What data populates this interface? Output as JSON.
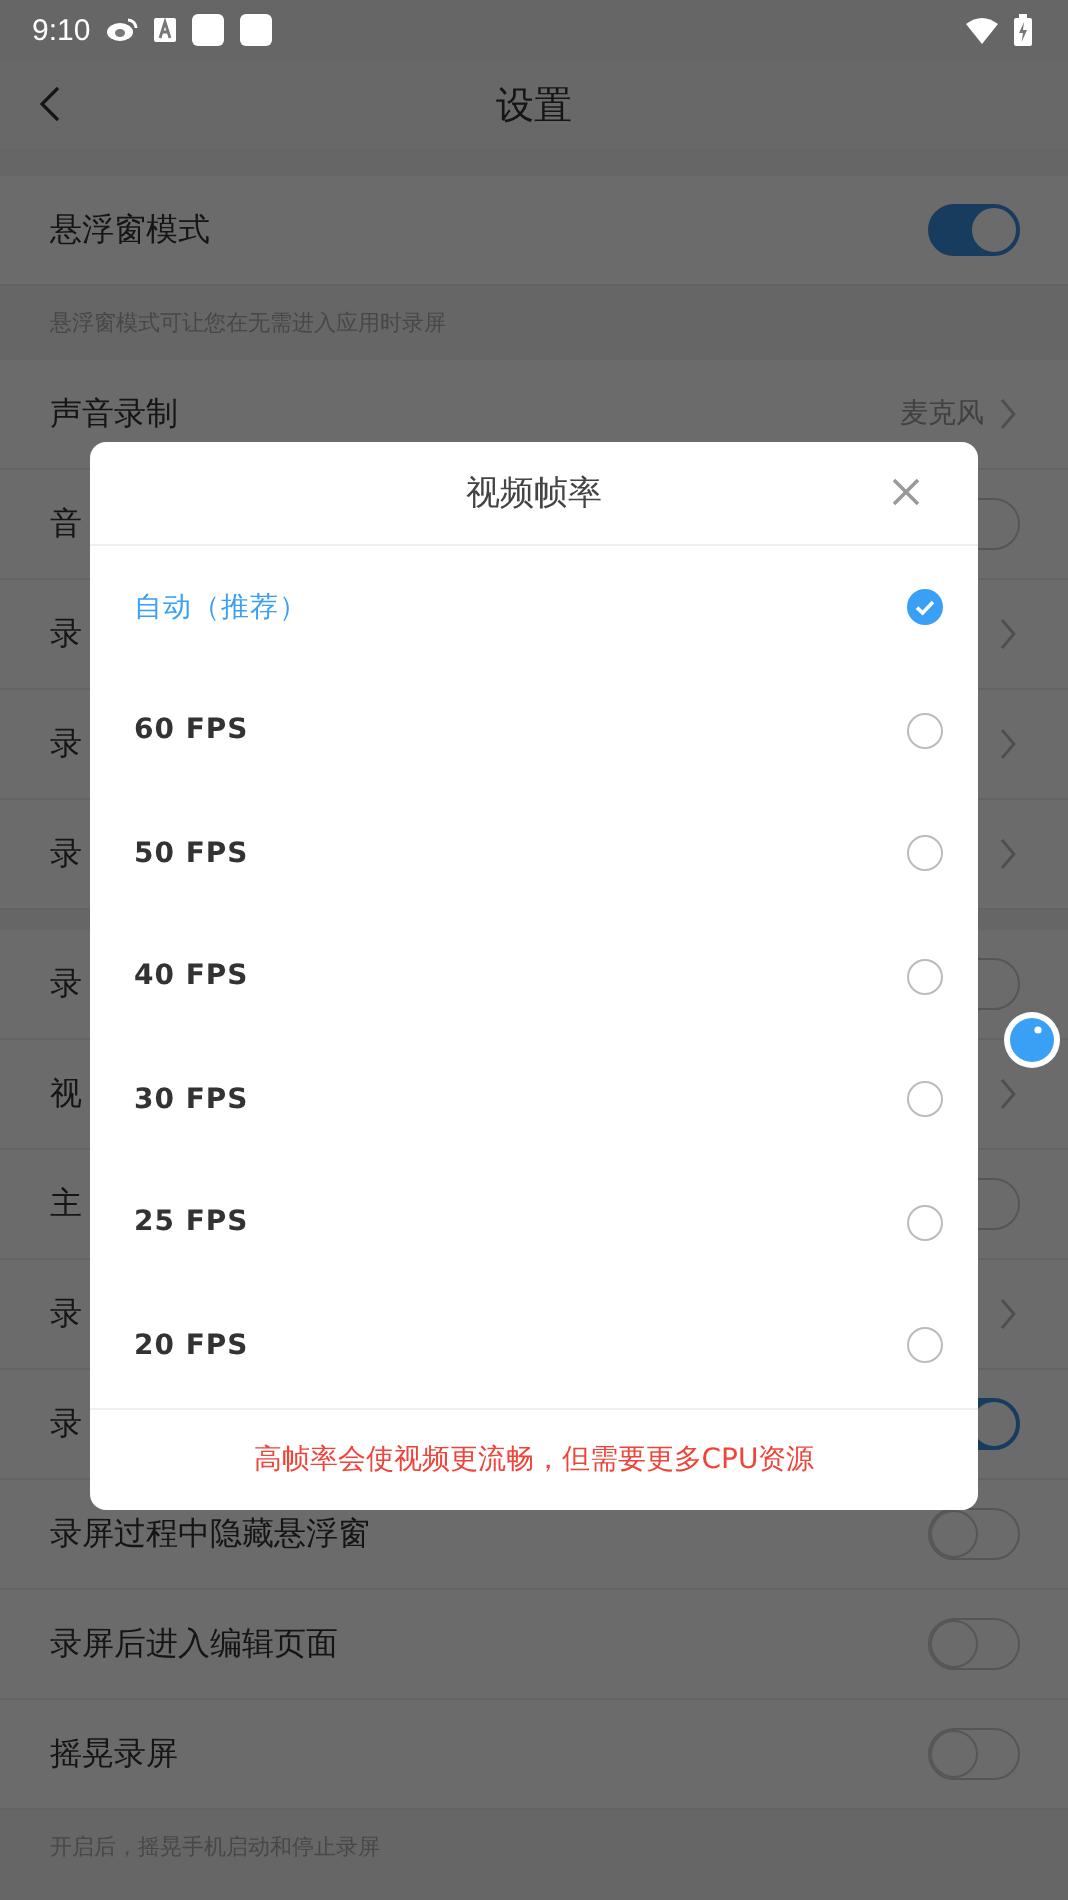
{
  "status_bar": {
    "time": "9:10"
  },
  "header": {
    "title": "设置"
  },
  "settings": [
    {
      "kind": "toggle",
      "label": "悬浮窗模式",
      "on": true
    },
    {
      "kind": "caption",
      "label": "悬浮窗模式可让您在无需进入应用时录屏"
    },
    {
      "kind": "link",
      "label": "声音录制",
      "value": "麦克风"
    },
    {
      "kind": "toggle",
      "label": "音",
      "on": false
    },
    {
      "kind": "link",
      "label": "录"
    },
    {
      "kind": "link",
      "label": "录"
    },
    {
      "kind": "link",
      "label": "录"
    },
    {
      "kind": "gap"
    },
    {
      "kind": "toggle",
      "label": "录",
      "on": false
    },
    {
      "kind": "link",
      "label": "视"
    },
    {
      "kind": "toggle",
      "label": "主",
      "on": false
    },
    {
      "kind": "link",
      "label": "录"
    },
    {
      "kind": "toggle",
      "label": "录",
      "on": true
    },
    {
      "kind": "toggle",
      "label": "录屏过程中隐藏悬浮窗",
      "on": false
    },
    {
      "kind": "toggle",
      "label": "录屏后进入编辑页面",
      "on": false
    },
    {
      "kind": "toggle",
      "label": "摇晃录屏",
      "on": false
    },
    {
      "kind": "caption",
      "label": "开启后，摇晃手机启动和停止录屏"
    }
  ],
  "dialog": {
    "title": "视频帧率",
    "options": [
      {
        "label": "自动（推荐）",
        "selected": true
      },
      {
        "label": "60 FPS",
        "selected": false
      },
      {
        "label": "50 FPS",
        "selected": false
      },
      {
        "label": "40 FPS",
        "selected": false
      },
      {
        "label": "30 FPS",
        "selected": false
      },
      {
        "label": "25 FPS",
        "selected": false
      },
      {
        "label": "20 FPS",
        "selected": false
      }
    ],
    "note": "高帧率会使视频更流畅，但需要更多CPU资源"
  }
}
